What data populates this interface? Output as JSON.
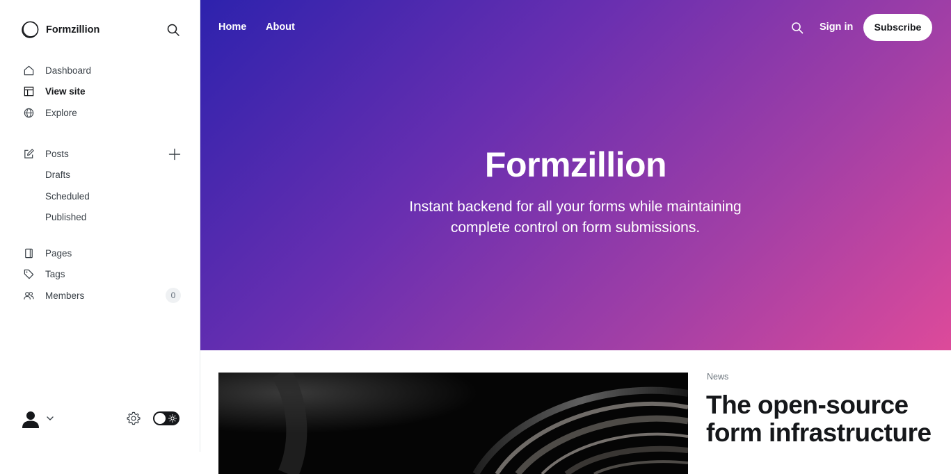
{
  "sidebar": {
    "brand": {
      "name": "Formzillion",
      "logo_icon": "circle-logo-icon"
    },
    "nav": [
      {
        "label": "Dashboard",
        "icon": "home-icon",
        "active": false
      },
      {
        "label": "View site",
        "icon": "layout-icon",
        "active": true
      },
      {
        "label": "Explore",
        "icon": "globe-icon",
        "active": false
      }
    ],
    "posts": {
      "label": "Posts",
      "icon": "edit-icon",
      "sub_items": [
        "Drafts",
        "Scheduled",
        "Published"
      ]
    },
    "secondary": [
      {
        "label": "Pages",
        "icon": "pages-icon"
      },
      {
        "label": "Tags",
        "icon": "tag-icon"
      },
      {
        "label": "Members",
        "icon": "members-icon",
        "count": "0"
      }
    ],
    "footer": {
      "avatar_icon": "user-avatar-icon",
      "settings_icon": "gear-icon",
      "theme_toggle": "dark-mode-toggle"
    }
  },
  "site": {
    "nav": {
      "home": "Home",
      "about": "About",
      "signin": "Sign in",
      "subscribe": "Subscribe"
    },
    "hero": {
      "title": "Formzillion",
      "description": "Instant backend for all your forms while maintaining complete control on form submissions.",
      "gradient": [
        "#2d22ad",
        "#6a2fb0",
        "#a23fa6",
        "#dd4a9a"
      ]
    },
    "featured_post": {
      "tag": "News",
      "title": "The open-source form infrastructure"
    }
  },
  "colors": {
    "accent": "#15171a",
    "muted": "#394047",
    "border": "#e6e9eb"
  }
}
